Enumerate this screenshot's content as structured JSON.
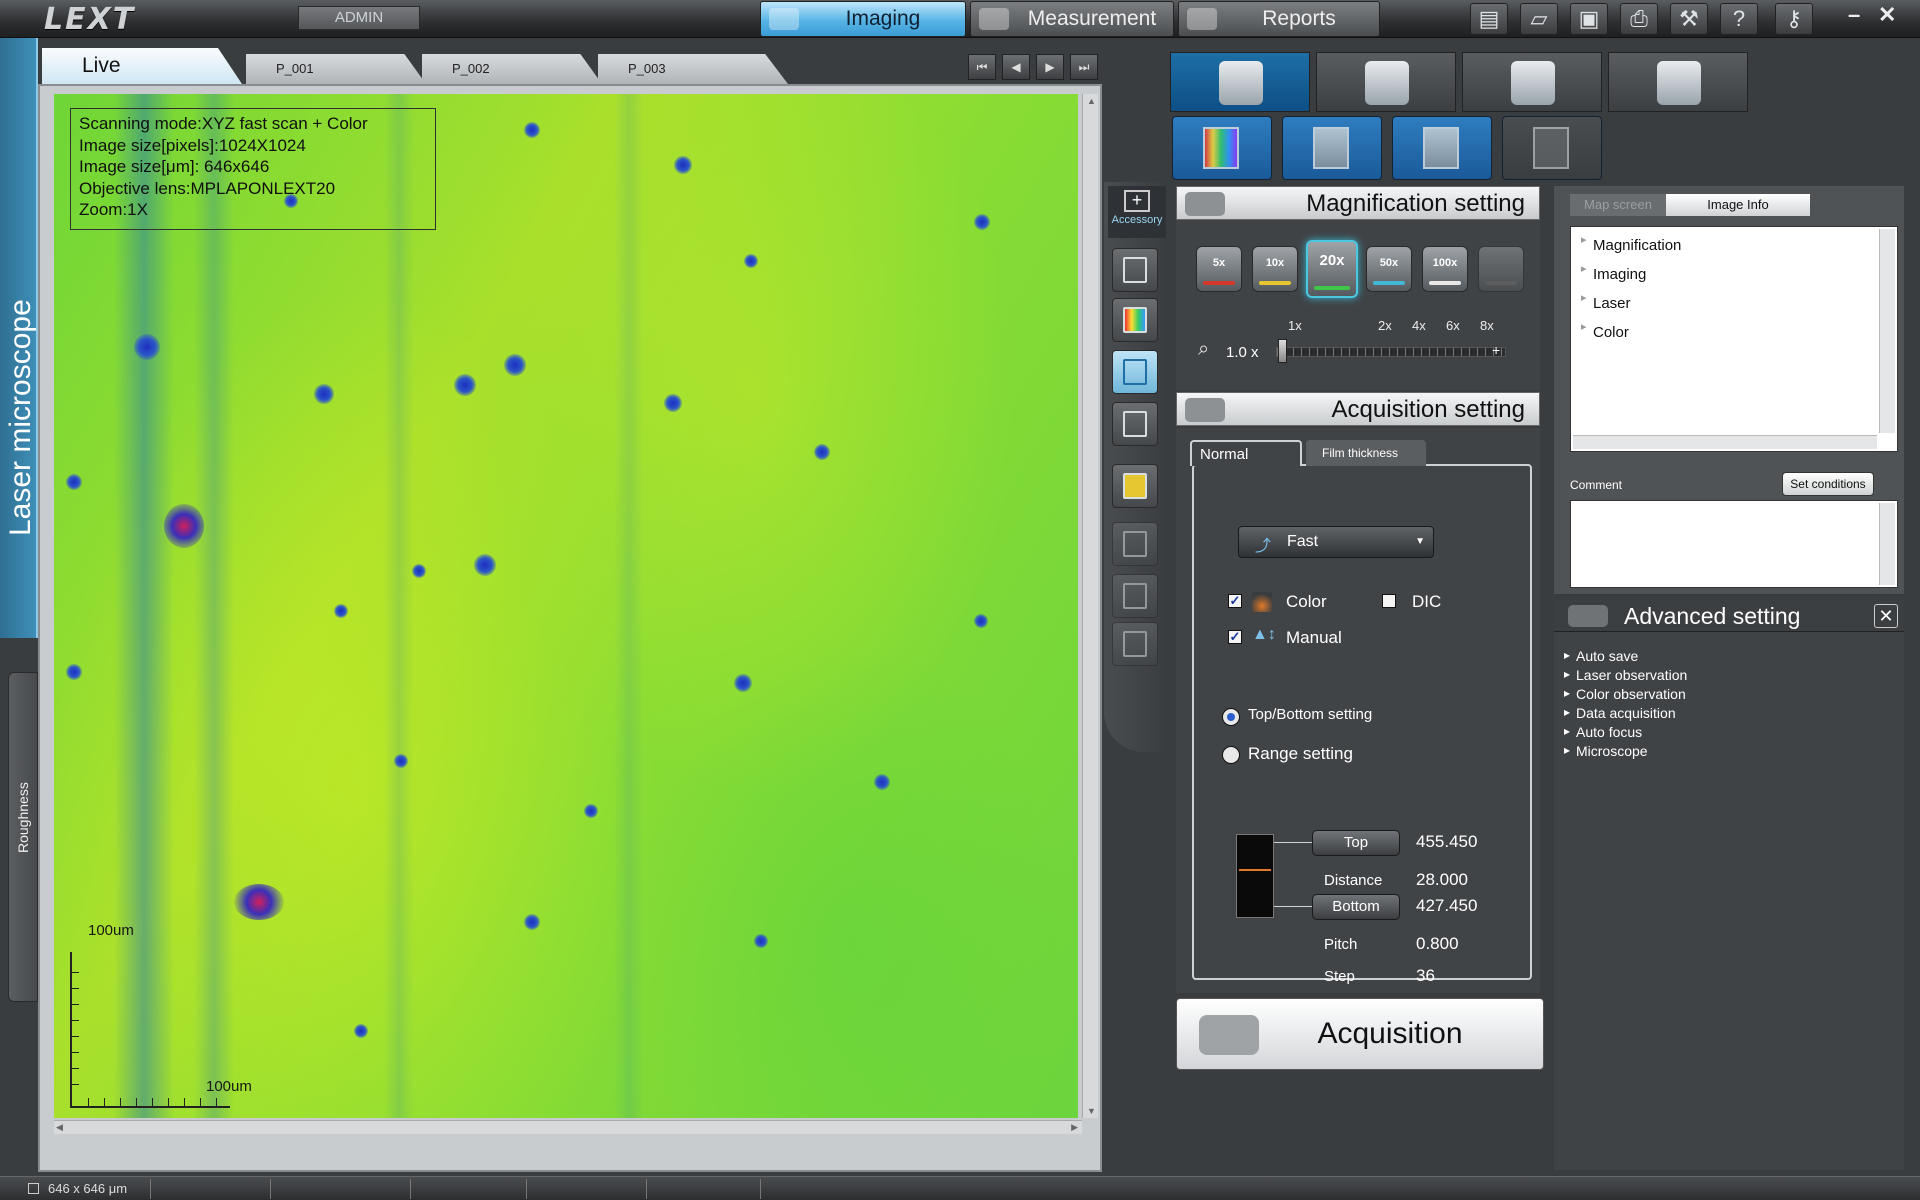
{
  "app": {
    "logo": "LEXT",
    "user_button": "ADMIN"
  },
  "modes": [
    {
      "label": "Imaging",
      "active": true
    },
    {
      "label": "Measurement",
      "active": false
    },
    {
      "label": "Reports",
      "active": false
    }
  ],
  "top_icons": [
    "report-icon",
    "open-folder-icon",
    "save-icon",
    "print-icon",
    "tools-icon",
    "help-icon",
    "key-icon"
  ],
  "window_controls": {
    "minimize": "–",
    "close": "✕"
  },
  "left_tabs": {
    "main": "Laser microscope",
    "secondary": "Roughness"
  },
  "image_tabs": [
    {
      "label": "Live"
    },
    {
      "label": "P_001"
    },
    {
      "label": "P_002"
    },
    {
      "label": "P_003"
    }
  ],
  "image_nav": {
    "first": "⏮",
    "prev": "◀",
    "next": "▶",
    "last": "⏭"
  },
  "image_info": {
    "lines": [
      "Scanning mode:XYZ fast scan + Color",
      "Image size[pixels]:1024X1024",
      "Image size[μm]: 646x646",
      "Objective lens:MPLAPONLEXT20",
      "Zoom:1X"
    ]
  },
  "scale": {
    "vertical_label": "100um",
    "horizontal_label": "100um"
  },
  "toolstrip": {
    "accessory_label": "Accessory"
  },
  "magnification": {
    "title": "Magnification setting",
    "lenses": [
      {
        "label": "5x",
        "ring": "#d4372c",
        "selected": false
      },
      {
        "label": "10x",
        "ring": "#e6c631",
        "selected": false
      },
      {
        "label": "20x",
        "ring": "#3fc74a",
        "selected": true
      },
      {
        "label": "50x",
        "ring": "#43b7d6",
        "selected": false
      },
      {
        "label": "100x",
        "ring": "#e8e8e8",
        "selected": false
      },
      {
        "label": "",
        "ring": "#777777",
        "selected": false
      }
    ],
    "zoom_ticks": [
      "1x",
      "2x",
      "4x",
      "6x",
      "8x"
    ],
    "zoom_value": "1.0",
    "zoom_unit": "x",
    "zoom_plus": "+"
  },
  "acquisition": {
    "title": "Acquisition setting",
    "tabs": [
      "Normal",
      "Film thickness"
    ],
    "mode": "Fast",
    "color_checked": true,
    "color_label": "Color",
    "dic_checked": false,
    "dic_label": "DIC",
    "manual_checked": true,
    "manual_label": "Manual",
    "top_bottom_label": "Top/Bottom setting",
    "range_label": "Range setting",
    "top_label": "Top",
    "top_value": "455.450",
    "distance_label": "Distance",
    "distance_value": "28.000",
    "bottom_label": "Bottom",
    "bottom_value": "427.450",
    "pitch_label": "Pitch",
    "pitch_value": "0.800",
    "step_label": "Step",
    "step_value": "36",
    "button_label": "Acquisition"
  },
  "info_panel": {
    "tabs": [
      "Map screen",
      "Image Info"
    ],
    "tree": [
      "Magnification",
      "Imaging",
      "Laser",
      "Color"
    ],
    "comment_label": "Comment",
    "set_conditions": "Set conditions"
  },
  "advanced": {
    "title": "Advanced setting",
    "close": "✕",
    "items": [
      "Auto save",
      "Laser observation",
      "Color observation",
      "Data acquisition",
      "Auto focus",
      "Microscope"
    ]
  },
  "status": {
    "size": "646 x 646 μm"
  },
  "colors": {
    "accent": "#58b4e6",
    "selected_lens_glow": "#49c8e0",
    "image_green": "#88dc34",
    "spot_blue": "#1d2fbf"
  }
}
